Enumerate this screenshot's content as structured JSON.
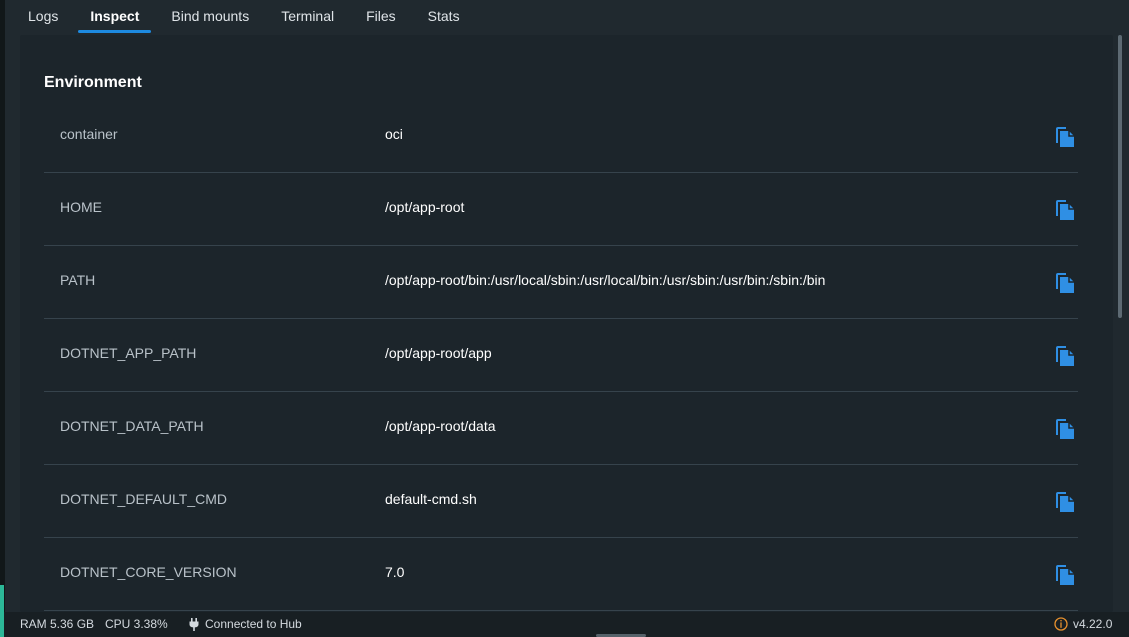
{
  "tabs": [
    {
      "label": "Logs",
      "active": false
    },
    {
      "label": "Inspect",
      "active": true
    },
    {
      "label": "Bind mounts",
      "active": false
    },
    {
      "label": "Terminal",
      "active": false
    },
    {
      "label": "Files",
      "active": false
    },
    {
      "label": "Stats",
      "active": false
    }
  ],
  "section": {
    "title": "Environment"
  },
  "environment": [
    {
      "key": "container",
      "value": "oci"
    },
    {
      "key": "HOME",
      "value": "/opt/app-root"
    },
    {
      "key": "PATH",
      "value": "/opt/app-root/bin:/usr/local/sbin:/usr/local/bin:/usr/sbin:/usr/bin:/sbin:/bin"
    },
    {
      "key": "DOTNET_APP_PATH",
      "value": "/opt/app-root/app"
    },
    {
      "key": "DOTNET_DATA_PATH",
      "value": "/opt/app-root/data"
    },
    {
      "key": "DOTNET_DEFAULT_CMD",
      "value": "default-cmd.sh"
    },
    {
      "key": "DOTNET_CORE_VERSION",
      "value": "7.0"
    }
  ],
  "icons": {
    "copy": "copy-icon",
    "hub": "plug-icon",
    "info": "info-circle-icon"
  },
  "statusbar": {
    "ram": "RAM 5.36 GB",
    "cpu": "CPU 3.38%",
    "hub": "Connected to Hub",
    "version": "v4.22.0"
  },
  "colors": {
    "accent": "#1d8ae0",
    "copy_icon": "#2f8fe4",
    "status_accent": "#2cb898",
    "warning": "#e8912e"
  }
}
